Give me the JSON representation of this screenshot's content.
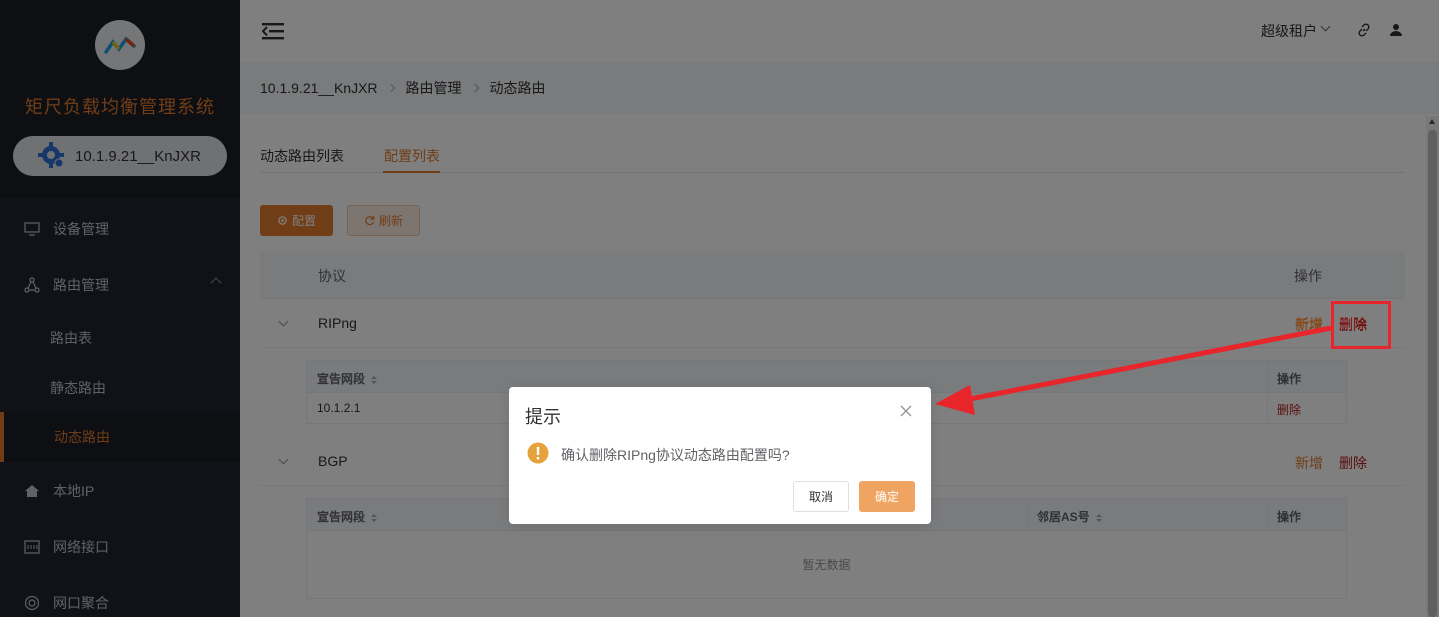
{
  "app": {
    "title": "矩尺负载均衡管理系统",
    "device_name": "10.1.9.21__KnJXR"
  },
  "sidebar": {
    "items": [
      {
        "label": "设备管理",
        "icon": "monitor-icon"
      },
      {
        "label": "路由管理",
        "icon": "network-icon"
      },
      {
        "label": "路由表"
      },
      {
        "label": "静态路由"
      },
      {
        "label": "动态路由",
        "active": true
      },
      {
        "label": "本地IP",
        "icon": "home-icon"
      },
      {
        "label": "网络接口",
        "icon": "interface-icon"
      },
      {
        "label": "网口聚合",
        "icon": "aggregate-icon"
      }
    ]
  },
  "header": {
    "user": "超级租户"
  },
  "breadcrumb": [
    "10.1.9.21__KnJXR",
    "路由管理",
    "动态路由"
  ],
  "tabs": [
    {
      "label": "动态路由列表"
    },
    {
      "label": "配置列表",
      "active": true
    }
  ],
  "toolbar": {
    "config_label": "配置",
    "refresh_label": "刷新"
  },
  "table": {
    "col_protocol": "协议",
    "col_action": "操作",
    "add_label": "新增",
    "delete_label": "删除",
    "rows": [
      {
        "protocol": "RIPng",
        "sub_headers": [
          "宣告网段",
          "操作"
        ],
        "sub_rows": [
          {
            "network": "10.1.2.1",
            "action": "删除"
          }
        ]
      },
      {
        "protocol": "BGP",
        "sub_headers": [
          "宣告网段",
          "邻居AS号",
          "操作"
        ],
        "empty_text": "暂无数据"
      }
    ]
  },
  "dialog": {
    "title": "提示",
    "message": "确认删除RIPng协议动态路由配置吗?",
    "cancel_label": "取消",
    "ok_label": "确定"
  },
  "colors": {
    "accent": "#e17a2d",
    "danger": "#b21d1d",
    "annotation": "#e8252b",
    "sidebar_bg": "#20242e"
  }
}
